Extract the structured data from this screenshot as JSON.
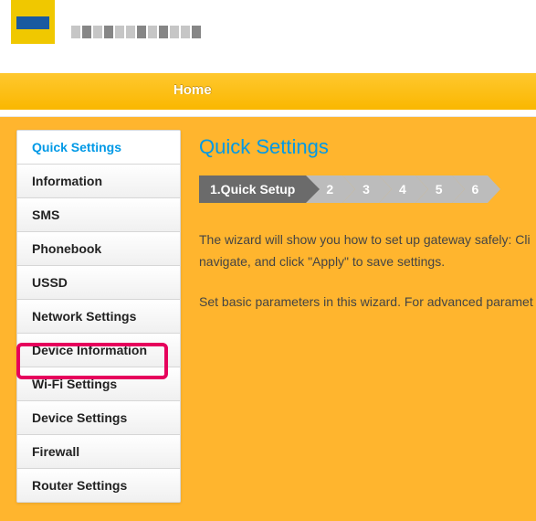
{
  "nav": {
    "home": "Home"
  },
  "sidebar": {
    "items": [
      {
        "label": "Quick Settings",
        "active": true
      },
      {
        "label": "Information"
      },
      {
        "label": "SMS"
      },
      {
        "label": "Phonebook"
      },
      {
        "label": "USSD"
      },
      {
        "label": "Network Settings"
      },
      {
        "label": "Device Information"
      },
      {
        "label": "Wi-Fi Settings",
        "highlighted": true
      },
      {
        "label": "Device Settings"
      },
      {
        "label": "Firewall"
      },
      {
        "label": "Router Settings"
      }
    ]
  },
  "main": {
    "title": "Quick Settings",
    "steps": {
      "active_label": "1.Quick Setup",
      "numbers": [
        "2",
        "3",
        "4",
        "5",
        "6"
      ]
    },
    "paragraph1a": "The wizard will show you how to set up gateway safely: Cli",
    "paragraph1b": "navigate, and click \"Apply\" to save settings.",
    "paragraph2": "Set basic parameters in this wizard. For advanced paramet"
  }
}
